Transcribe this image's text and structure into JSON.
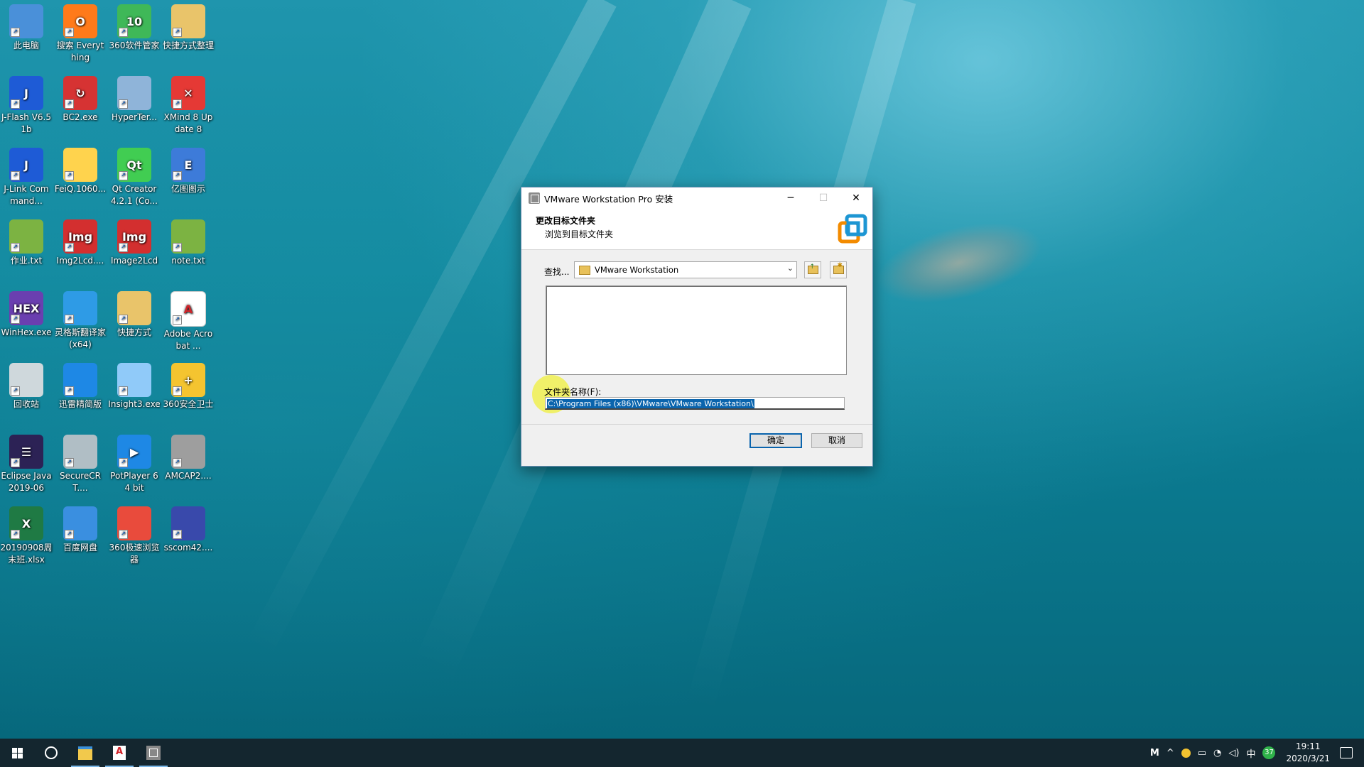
{
  "desktop": {
    "icons": [
      {
        "label": "此电脑",
        "icon": "computer-icon",
        "color": "#4a90d9",
        "glyph": ""
      },
      {
        "label": "搜索 Everything",
        "icon": "search-icon",
        "color": "#ff7a1a",
        "glyph": "O"
      },
      {
        "label": "360软件管家",
        "icon": "360-software-manager-icon",
        "color": "#3fb858",
        "glyph": "10"
      },
      {
        "label": "快捷方式整理",
        "icon": "folder-zip-icon",
        "color": "#e9c46a",
        "glyph": ""
      },
      {
        "label": "J-Flash V6.51b",
        "icon": "jflash-icon",
        "color": "#1e5bd6",
        "glyph": "J"
      },
      {
        "label": "BC2.exe",
        "icon": "beyond-compare-icon",
        "color": "#d63333",
        "glyph": "↻"
      },
      {
        "label": "HyperTer...",
        "icon": "hyperterminal-icon",
        "color": "#8fb4d9",
        "glyph": ""
      },
      {
        "label": "XMind 8 Update 8",
        "icon": "xmind-icon",
        "color": "#e53935",
        "glyph": "✕"
      },
      {
        "label": "J-Link Command...",
        "icon": "jlink-icon",
        "color": "#1e5bd6",
        "glyph": "J"
      },
      {
        "label": "FeiQ.1060...",
        "icon": "feiq-icon",
        "color": "#ffd34d",
        "glyph": ""
      },
      {
        "label": "Qt Creator 4.2.1 (Co...",
        "icon": "qt-creator-icon",
        "color": "#41cd52",
        "glyph": "Qt"
      },
      {
        "label": "亿图图示",
        "icon": "edraw-icon",
        "color": "#3d7bd9",
        "glyph": "E"
      },
      {
        "label": "作业.txt",
        "icon": "text-file-icon",
        "color": "#7cb342",
        "glyph": ""
      },
      {
        "label": "Img2Lcd....",
        "icon": "img2lcd-icon",
        "color": "#d32f2f",
        "glyph": "Img"
      },
      {
        "label": "Image2Lcd",
        "icon": "image2lcd-icon",
        "color": "#d32f2f",
        "glyph": "Img"
      },
      {
        "label": "note.txt",
        "icon": "text-file-icon",
        "color": "#7cb342",
        "glyph": ""
      },
      {
        "label": "WinHex.exe",
        "icon": "winhex-icon",
        "color": "#6a3fb0",
        "glyph": "HEX"
      },
      {
        "label": "灵格斯翻译家 (x64)",
        "icon": "lingoes-icon",
        "color": "#2e9be6",
        "glyph": ""
      },
      {
        "label": "快捷方式",
        "icon": "shortcut-folder-icon",
        "color": "#e9c46a",
        "glyph": ""
      },
      {
        "label": "Adobe Acrobat ...",
        "icon": "acrobat-icon",
        "color": "#ffffff",
        "glyph": "A"
      },
      {
        "label": "回收站",
        "icon": "recycle-bin-icon",
        "color": "#cfd8dc",
        "glyph": ""
      },
      {
        "label": "迅雷精简版",
        "icon": "thunder-icon",
        "color": "#1e88e5",
        "glyph": ""
      },
      {
        "label": "Insight3.exe",
        "icon": "insight-icon",
        "color": "#90caf9",
        "glyph": ""
      },
      {
        "label": "360安全卫士",
        "icon": "360-security-icon",
        "color": "#f4c430",
        "glyph": "+"
      },
      {
        "label": "Eclipse Java 2019-06",
        "icon": "eclipse-icon",
        "color": "#2c2255",
        "glyph": "☰"
      },
      {
        "label": "SecureCRT....",
        "icon": "securecrt-icon",
        "color": "#b0bec5",
        "glyph": ""
      },
      {
        "label": "PotPlayer 64 bit",
        "icon": "potplayer-icon",
        "color": "#1e88e5",
        "glyph": "▶"
      },
      {
        "label": "AMCAP2....",
        "icon": "amcap-icon",
        "color": "#9e9e9e",
        "glyph": ""
      },
      {
        "label": "20190908周末班.xlsx",
        "icon": "excel-file-icon",
        "color": "#1f7a44",
        "glyph": "X"
      },
      {
        "label": "百度网盘",
        "icon": "baidu-netdisk-icon",
        "color": "#3a8fe0",
        "glyph": ""
      },
      {
        "label": "360极速浏览器",
        "icon": "360-browser-icon",
        "color": "#e94b3c",
        "glyph": ""
      },
      {
        "label": "sscom42....",
        "icon": "sscom-icon",
        "color": "#3949ab",
        "glyph": ""
      }
    ]
  },
  "dialog": {
    "title": "VMware Workstation Pro 安装",
    "heading": "更改目标文件夹",
    "subheading": "浏览到目标文件夹",
    "look_in_label": "查找...",
    "look_in_value": "VMware Workstation",
    "folder_name_label": "文件夹名称(F):",
    "folder_name_value": "C:\\Program Files (x86)\\VMware\\VMware Workstation\\",
    "ok_label": "确定",
    "cancel_label": "取消",
    "minimize_glyph": "─",
    "maximize_glyph": "☐",
    "close_glyph": "✕"
  },
  "taskbar": {
    "tray_m": "M",
    "tray_chevron": "^",
    "ime": "中",
    "badge": "37",
    "time": "19:11",
    "date": "2020/3/21"
  },
  "colors": {
    "accent": "#0a64ad",
    "vmware_orange": "#f38b00",
    "vmware_blue": "#1d96d3"
  }
}
